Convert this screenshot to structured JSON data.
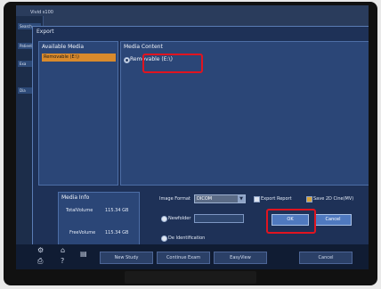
{
  "app": {
    "title": "Vivid s100"
  },
  "background": {
    "tabs": [
      "Search",
      "Patient",
      "Exa",
      "Dia"
    ]
  },
  "dialog": {
    "title": "Export",
    "available_media": {
      "heading": "Available Media",
      "items": [
        "Removable (E:\\)"
      ]
    },
    "media_content": {
      "heading": "Media Content",
      "items": [
        "Removable (E:\\)"
      ]
    },
    "media_info": {
      "heading": "Media Info",
      "total_volume_label": "TotalVolume",
      "total_volume_value": "115.34 GB",
      "free_volume_label": "FreeVolume",
      "free_volume_value": "115.34 GB"
    },
    "image_format": {
      "label": "Image Format",
      "value": "DICOM"
    },
    "export_report": {
      "label": "Export Report",
      "checked": false
    },
    "save_2d_cine": {
      "label": "Save 2D Cine(MV)",
      "checked": true
    },
    "newfolder": {
      "label": "Newfolder",
      "value": ""
    },
    "deidentification": {
      "label": "De Identification"
    },
    "ok_label": "OK",
    "cancel_label": "Cancel"
  },
  "softkeys": {
    "new_study": "New Study",
    "continue_exam": "Continue Exam",
    "easyview": "EasyView",
    "cancel": "Cancel"
  },
  "colors": {
    "annotation": "#e01420",
    "selected_media": "#d98a2c",
    "dialog_bg": "#1e3157"
  }
}
